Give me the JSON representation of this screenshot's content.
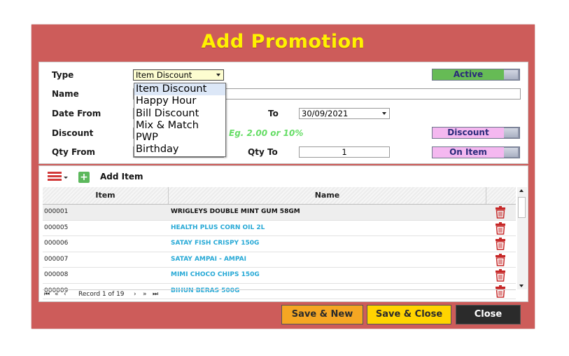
{
  "title": "Add Promotion",
  "form": {
    "type_label": "Type",
    "type_value": "Item Discount",
    "type_options": [
      "Item Discount",
      "Happy Hour",
      "Bill Discount",
      "Mix & Match",
      "PWP",
      "Birthday"
    ],
    "name_label": "Name",
    "name_value": "",
    "date_from_label": "Date From",
    "to_label": "To",
    "date_to_value": "30/09/2021",
    "discount_label": "Discount",
    "discount_hint": "Eg. 2.00 or 10%",
    "qty_from_label": "Qty From",
    "qty_to_label": "Qty To",
    "qty_to_value": "1",
    "toggles": {
      "active": {
        "label": "Active",
        "color": "#66bb55"
      },
      "discount": {
        "label": "Discount",
        "color": "#f4b8f0"
      },
      "on_item": {
        "label": "On Item",
        "color": "#f4b8f0"
      }
    }
  },
  "grid": {
    "add_item_label": "Add Item",
    "columns": {
      "item": "Item",
      "name": "Name"
    },
    "rows": [
      {
        "code": "000001",
        "name": "WRIGLEYS DOUBLE MINT GUM 58GM"
      },
      {
        "code": "000005",
        "name": "HEALTH PLUS CORN OIL 2L"
      },
      {
        "code": "000006",
        "name": "SATAY FISH CRISPY 150G"
      },
      {
        "code": "000007",
        "name": "SATAY AMPAI - AMPAI"
      },
      {
        "code": "000008",
        "name": "MIMI CHOCO CHIPS 150G"
      },
      {
        "code": "000009",
        "name": "BIHUN BERAS 500G"
      }
    ],
    "record_text": "Record 1 of 19"
  },
  "buttons": {
    "save_new": {
      "label": "Save & New",
      "color": "#f5a623"
    },
    "save_close": {
      "label": "Save & Close",
      "color": "#ffd400"
    },
    "close": {
      "label": "Close",
      "color": "#2b2b2b"
    }
  },
  "colors": {
    "dialog_bg": "#cd5c5a",
    "title": "#fff200",
    "row_name": "#27a9d6"
  }
}
